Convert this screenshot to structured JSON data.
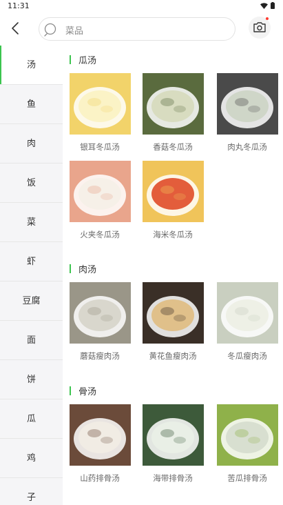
{
  "status": {
    "time": "11:31"
  },
  "search": {
    "placeholder": "菜品"
  },
  "sidebar": {
    "items": [
      "汤",
      "鱼",
      "肉",
      "饭",
      "菜",
      "虾",
      "豆腐",
      "面",
      "饼",
      "瓜",
      "鸡",
      "子"
    ],
    "active_index": 0
  },
  "sections": [
    {
      "title": "瓜汤",
      "dishes": [
        {
          "name": "银耳冬瓜汤",
          "colors": [
            "#f2d36a",
            "#fbf3c6"
          ]
        },
        {
          "name": "香菇冬瓜汤",
          "colors": [
            "#5a6b3e",
            "#d8dcc0"
          ]
        },
        {
          "name": "肉丸冬瓜汤",
          "colors": [
            "#4a4a4a",
            "#cfd6c8"
          ]
        },
        {
          "name": "火夹冬瓜汤",
          "colors": [
            "#e9a58c",
            "#f6f0e8"
          ]
        },
        {
          "name": "海米冬瓜汤",
          "colors": [
            "#f0c45a",
            "#e35d3b"
          ]
        }
      ]
    },
    {
      "title": "肉汤",
      "dishes": [
        {
          "name": "蘑菇瘦肉汤",
          "colors": [
            "#9a9688",
            "#d9d7cd"
          ]
        },
        {
          "name": "黄花鱼瘦肉汤",
          "colors": [
            "#3a2f27",
            "#e0c08a"
          ]
        },
        {
          "name": "冬瓜瘦肉汤",
          "colors": [
            "#c9cfc0",
            "#eef0e6"
          ]
        }
      ]
    },
    {
      "title": "骨汤",
      "dishes": [
        {
          "name": "山药排骨汤",
          "colors": [
            "#6b4b3a",
            "#f1ece4"
          ]
        },
        {
          "name": "海带排骨汤",
          "colors": [
            "#3d5a3a",
            "#e9efe6"
          ]
        },
        {
          "name": "苦瓜排骨汤",
          "colors": [
            "#8fb14a",
            "#d8dfd0"
          ]
        }
      ]
    }
  ]
}
